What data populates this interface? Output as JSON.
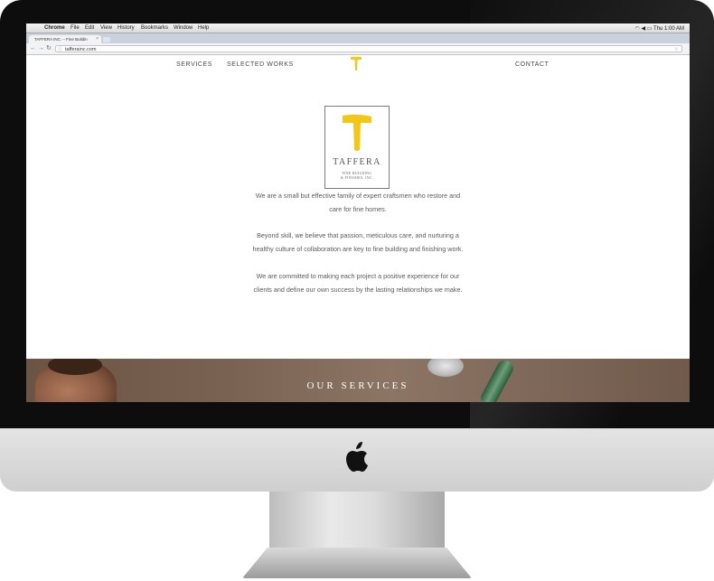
{
  "menubar": {
    "app": "Chrome",
    "items": [
      "File",
      "Edit",
      "View",
      "History",
      "Bookmarks",
      "Window",
      "Help"
    ],
    "clock": "Thu 1:00 AM"
  },
  "browser": {
    "tab_title": "TAFFERA INC. – Fine Buildin",
    "tab_close": "×",
    "url": "tafferainc.com"
  },
  "site": {
    "nav": {
      "services": "SERVICES",
      "selected_works": "SELECTED WORKS",
      "contact": "CONTACT"
    },
    "logo": {
      "name": "TAFFERA",
      "sub_line1": "FINE BUILDING",
      "sub_line2": "& FINISHES, INC.",
      "accent": "#f5c518"
    },
    "paragraphs": {
      "p1_line1": "We are a small but effective family of expert craftsmen who restore and",
      "p1_line2": "care for fine homes.",
      "p2_line1": "Beyond skill, we believe that passion, meticulous care, and nurturing a",
      "p2_line2": "healthy culture of collaboration are key to fine building and finishing work.",
      "p3_line1": "We are committed to making each project a positive experience for our",
      "p3_line2": "clients and define our own success by the lasting relationships we make."
    },
    "banner_title": "OUR SERVICES"
  }
}
